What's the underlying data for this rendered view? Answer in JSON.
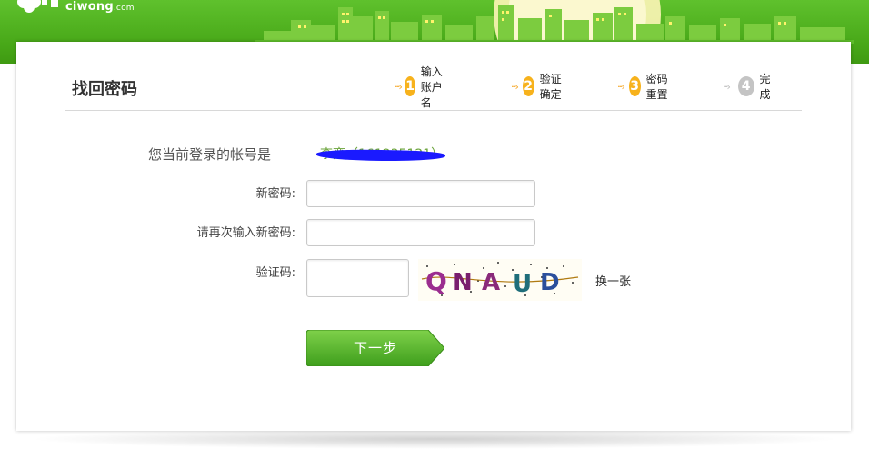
{
  "header": {
    "logo_text": "ciwong",
    "logo_domain": ".com"
  },
  "page": {
    "title": "找回密码"
  },
  "steps": [
    {
      "number": "1",
      "label": "输入账户名",
      "state": "done"
    },
    {
      "number": "2",
      "label": "验证确定",
      "state": "done"
    },
    {
      "number": "3",
      "label": "密码重置",
      "state": "current"
    },
    {
      "number": "4",
      "label": "完成",
      "state": "pending"
    }
  ],
  "form": {
    "account_label": "您当前登录的帐号是",
    "account_value": "李奕（161235121）",
    "new_password_label": "新密码:",
    "new_password_value": "",
    "confirm_password_label": "请再次输入新密码:",
    "confirm_password_value": "",
    "captcha_label": "验证码:",
    "captcha_value": "",
    "captcha_text": "QNAUD",
    "refresh_label": "换一张",
    "next_button_label": "下一步"
  },
  "colors": {
    "header_green": "#48a818",
    "step_active": "#f7b21c",
    "step_inactive": "#c4c4c4",
    "button_green": "#4caf2a",
    "account_scribble": "#1a1aff"
  }
}
